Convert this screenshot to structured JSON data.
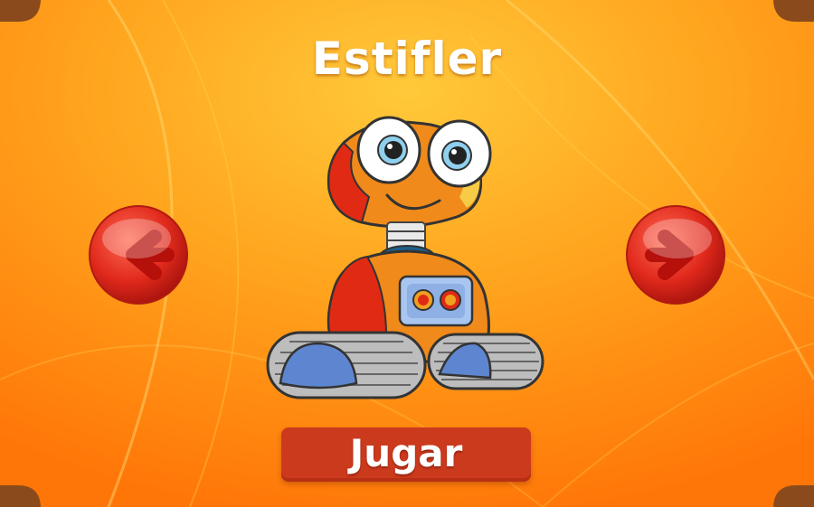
{
  "screen": {
    "title": "Estifler",
    "play_label": "Jugar"
  },
  "icons": {
    "prev": "left-arrow-icon",
    "next": "right-arrow-icon",
    "character": "robot-character"
  },
  "colors": {
    "frame": "#8a4a1c",
    "background_light": "#ffbd2e",
    "background_dark": "#ff7a0a",
    "arrow_red": "#e0291c",
    "play_button": "#cc3a1e",
    "robot_orange": "#f08a1a",
    "robot_red": "#e02a14",
    "robot_blue": "#5e86d0"
  }
}
